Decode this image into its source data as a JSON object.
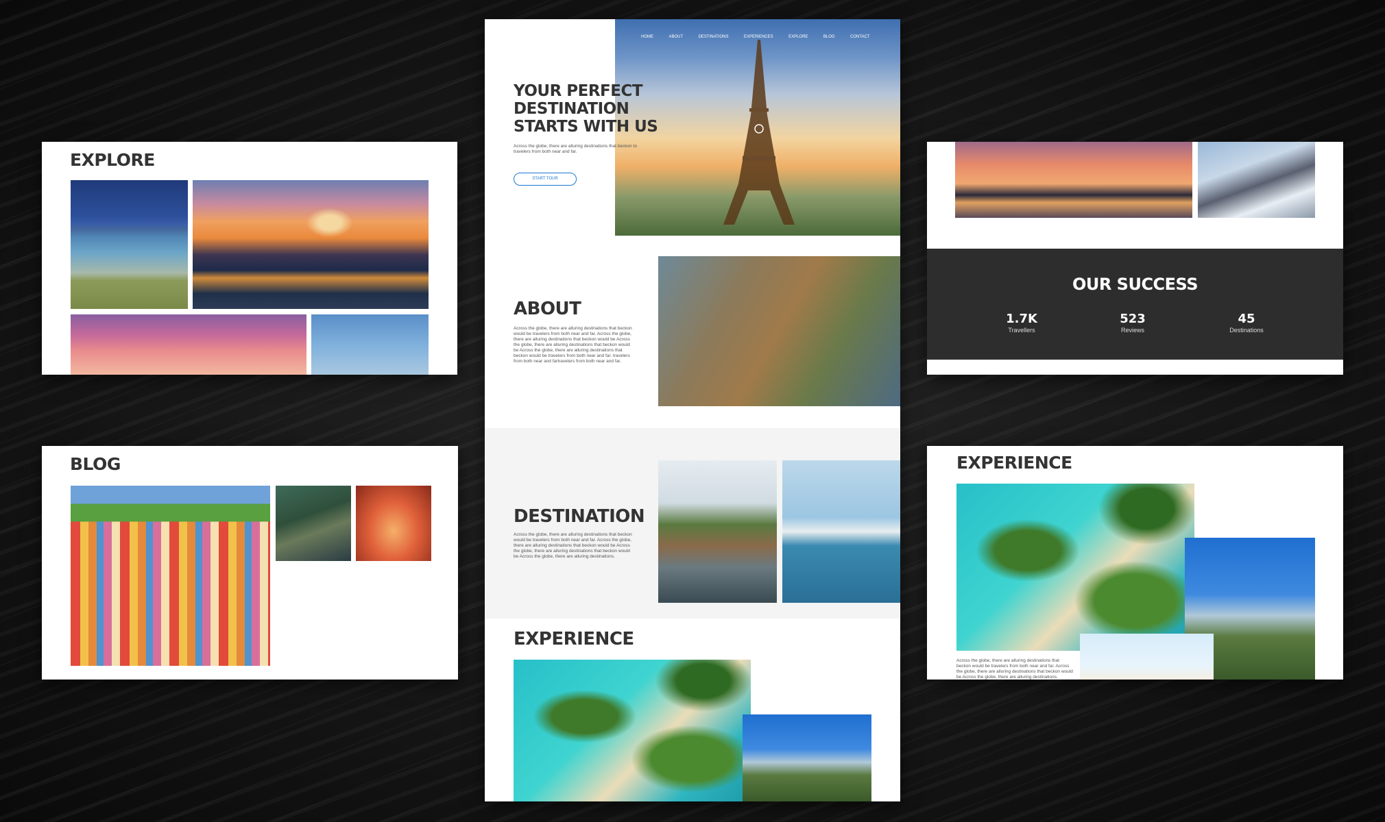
{
  "colors": {
    "accent": "#1976d2",
    "dark_band": "#2d2d2d",
    "heading": "#333333"
  },
  "explore_card": {
    "title": "EXPLORE"
  },
  "blog_card": {
    "title": "BLOG"
  },
  "hero_page": {
    "nav": [
      "HOME",
      "ABOUT",
      "DESTINATIONS",
      "EXPERIENCES",
      "EXPLORE",
      "BLOG",
      "CONTACT"
    ],
    "hero": {
      "title_lines": [
        "YOUR PERFECT",
        "DESTINATION",
        "STARTS WITH US"
      ],
      "text": "Across the globe, there are alluring destinations that beckon to travelers from both near and far.",
      "button": "START TOUR"
    },
    "about": {
      "title": "ABOUT",
      "text": "Across the globe, there are alluring destinations that beckon would be travelers from both near and far. Across the globe, there are alluring destinations that beckon would be Across the globe, there are alluring destinations that beckon would be Across the globe, there are alluring destinations that beckon would be travelers from both near and far. travelers from both near and fartravelers from both near and far."
    },
    "destination": {
      "title": "DESTINATION",
      "text": "Across the globe, there are alluring destinations that beckon would be travelers from both near and far. Across the globe, there are alluring destinations that beckon would be Across the globe, there are alluring destinations that beckon would be Across the globe, there are alluring destinations."
    },
    "experience": {
      "title": "EXPERIENCE"
    }
  },
  "success_card": {
    "title": "OUR SUCCESS",
    "stats": [
      {
        "value": "1.7K",
        "label": "Travellers"
      },
      {
        "value": "523",
        "label": "Reviews"
      },
      {
        "value": "45",
        "label": "Destinations"
      }
    ]
  },
  "experience_card": {
    "title": "EXPERIENCE",
    "text": "Across the globe, there are alluring destinations that beckon would be travelers from both near and far. Across the globe, there are alluring destinations that beckon would be Across the globe, there are alluring destinations."
  }
}
